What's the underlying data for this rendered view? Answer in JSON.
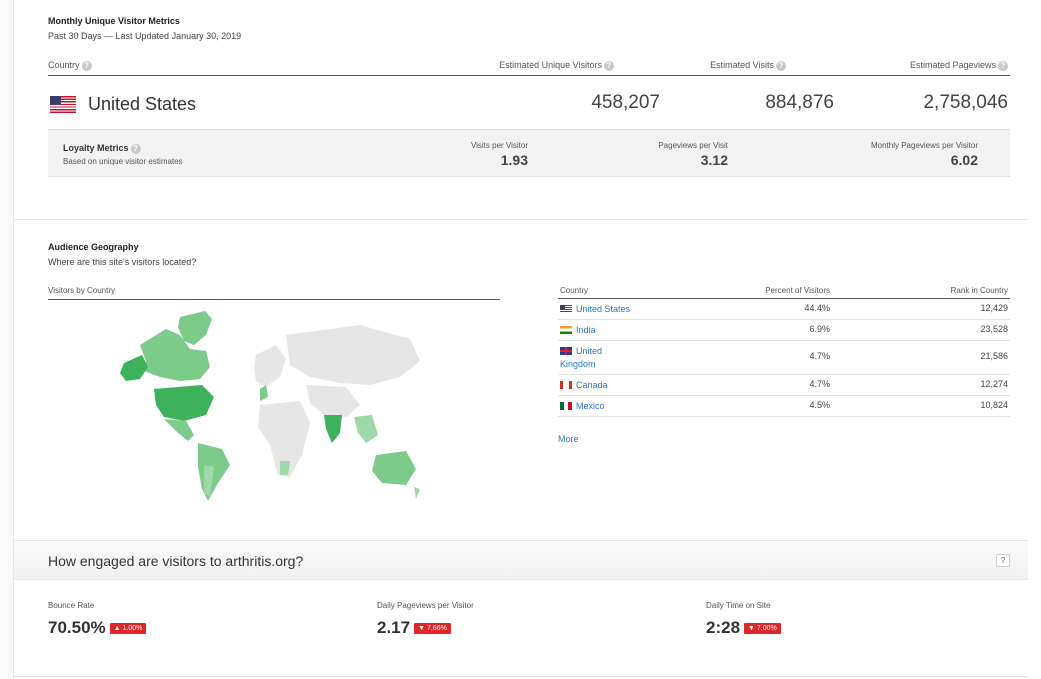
{
  "metrics": {
    "title": "Monthly Unique Visitor Metrics",
    "subtitle": "Past 30 Days — Last Updated January 30, 2019",
    "headers": {
      "country": "Country",
      "unique_visitors": "Estimated Unique Visitors",
      "visits": "Estimated Visits",
      "pageviews": "Estimated Pageviews"
    },
    "row": {
      "country": "United States",
      "unique_visitors": "458,207",
      "visits": "884,876",
      "pageviews": "2,758,046"
    },
    "loyalty": {
      "title": "Loyalty Metrics",
      "subtitle": "Based on unique visitor estimates",
      "visits_per_visitor_label": "Visits per Visitor",
      "visits_per_visitor": "1.93",
      "pageviews_per_visit_label": "Pageviews per Visit",
      "pageviews_per_visit": "3.12",
      "monthly_pageviews_label": "Monthly Pageviews per Visitor",
      "monthly_pageviews": "6.02"
    }
  },
  "geography": {
    "title": "Audience Geography",
    "subtitle": "Where are this site's visitors located?",
    "map_label": "Visitors by Country",
    "table_headers": {
      "country": "Country",
      "percent": "Percent of Visitors",
      "rank": "Rank in Country"
    },
    "rows": [
      {
        "country": "United States",
        "percent": "44.4%",
        "rank": "12,429",
        "flag": "us-flag-icon"
      },
      {
        "country": "India",
        "percent": "6.9%",
        "rank": "23,528",
        "flag": "in-flag-icon"
      },
      {
        "country": "United Kingdom",
        "percent": "4.7%",
        "rank": "21,586",
        "flag": "uk-flag-icon"
      },
      {
        "country": "Canada",
        "percent": "4.7%",
        "rank": "12,274",
        "flag": "ca-flag-icon"
      },
      {
        "country": "Mexico",
        "percent": "4.5%",
        "rank": "10,824",
        "flag": "mx-flag-icon"
      }
    ],
    "more_label": "More"
  },
  "engagement": {
    "title": "How engaged are visitors to arthritis.org?",
    "help_label": "?",
    "bounce_label": "Bounce Rate",
    "bounce_value": "70.50%",
    "bounce_change": "▲ 1.00%",
    "pageviews_label": "Daily Pageviews per Visitor",
    "pageviews_value": "2.17",
    "pageviews_change": "▼ 7.66%",
    "time_label": "Daily Time on Site",
    "time_value": "2:28",
    "time_change": "▼ 7.00%"
  },
  "colors": {
    "accent_link": "#2a76c6",
    "badge_red": "#e0262a",
    "map_high": "#3db25a",
    "map_mid": "#7ccb8a",
    "map_none": "#e6e6e6"
  }
}
